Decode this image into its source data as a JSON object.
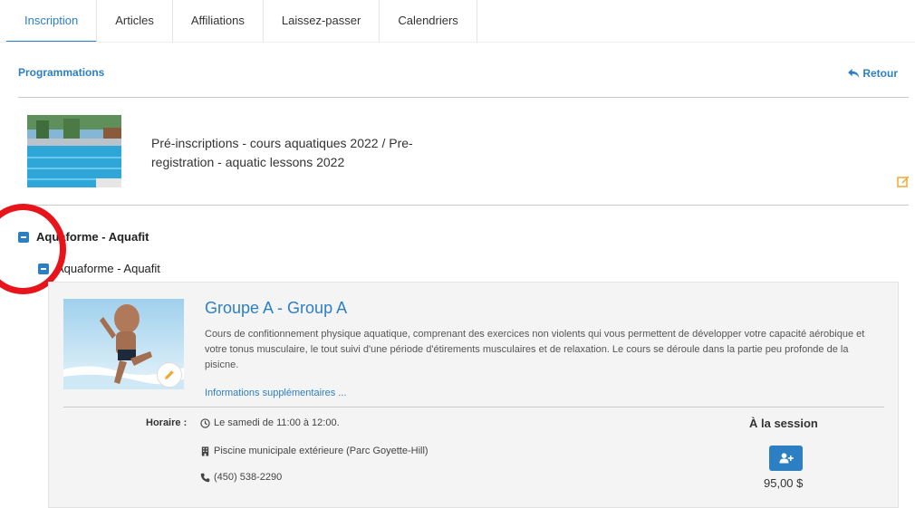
{
  "tabs": [
    {
      "label": "Inscription",
      "active": true
    },
    {
      "label": "Articles",
      "active": false
    },
    {
      "label": "Affiliations",
      "active": false
    },
    {
      "label": "Laissez-passer",
      "active": false
    },
    {
      "label": "Calendriers",
      "active": false
    }
  ],
  "header": {
    "programmations": "Programmations",
    "retour": "Retour"
  },
  "program": {
    "title": "Pré-inscriptions - cours aquatiques 2022 / Pre-registration - aquatic lessons 2022"
  },
  "tree": {
    "level1": "Aquaforme - Aquafit",
    "level2": "Aquaforme - Aquafit"
  },
  "course": {
    "title": "Groupe A - Group A",
    "description": "Cours de confitionnement physique aquatique, comprenant des exercices non violents qui vous permettent de développer votre capacité aérobique et votre tonus musculaire, le tout suivi d'une période d'étirements musculaires et de relaxation. Le cours se déroule dans la partie peu profonde de la pisicne.",
    "more_info": "Informations supplémentaires ...",
    "horaire_label": "Horaire :",
    "schedule": "Le samedi de 11:00 à 12:00.",
    "location": "Piscine municipale extérieure (Parc Goyette-Hill)",
    "phone": "(450) 538-2290",
    "session_label": "À la session",
    "price": "95,00 $"
  },
  "colors": {
    "accent": "#2d7fc4",
    "highlight_circle": "#e8141b"
  }
}
